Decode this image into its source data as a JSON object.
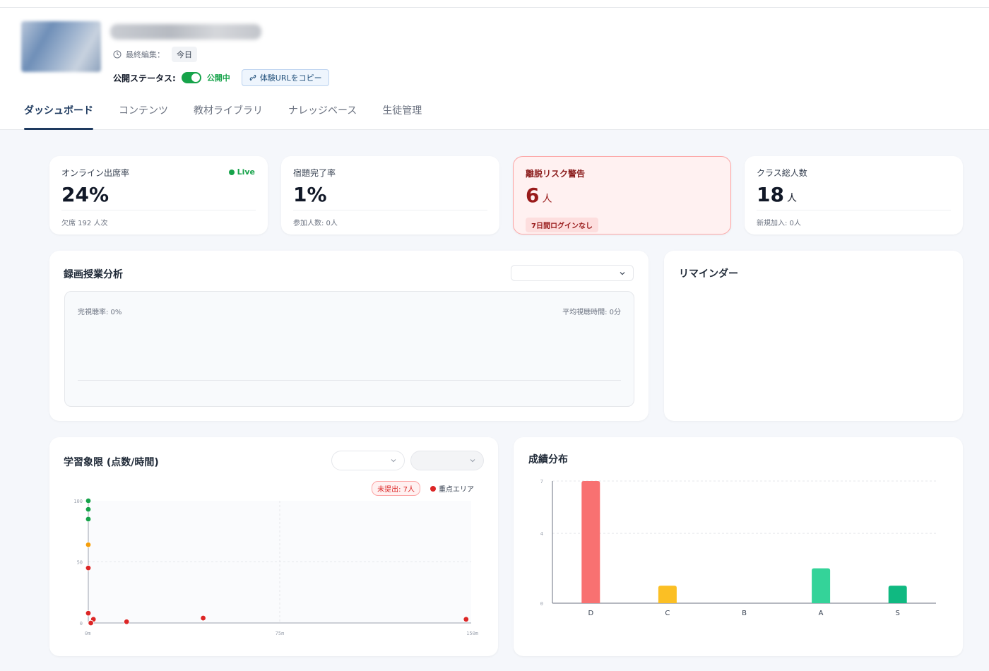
{
  "header": {
    "last_edited_label": "最終編集：",
    "last_edited_value": "今日",
    "status_label": "公開ステータス:",
    "status_value": "公開中",
    "copy_url_label": "体験URLをコピー"
  },
  "tabs": [
    {
      "label": "ダッシュボード"
    },
    {
      "label": "コンテンツ"
    },
    {
      "label": "教材ライブラリ"
    },
    {
      "label": "ナレッジベース"
    },
    {
      "label": "生徒管理"
    }
  ],
  "stats": {
    "attendance": {
      "title": "オンライン出席率",
      "value": "24%",
      "live": "Live",
      "sub": "欠席 192 人次"
    },
    "homework": {
      "title": "宿題完了率",
      "value": "1%",
      "sub": "参加人数: 0人"
    },
    "risk": {
      "title": "離脱リスク警告",
      "value": "6",
      "unit": "人",
      "badge": "7日間ログインなし"
    },
    "class_total": {
      "title": "クラス総人数",
      "value": "18",
      "unit": "人",
      "sub": "新規加入: 0人"
    }
  },
  "video_analysis": {
    "title": "録画授業分析",
    "completion": "完視聴率: 0%",
    "avg_time": "平均視聴時間: 0分"
  },
  "reminder": {
    "title": "リマインダー"
  },
  "quadrant": {
    "title": "学習象限 (点数/時間)",
    "unsubmitted_badge": "未提出: 7人",
    "legend_focus": "重点エリア"
  },
  "grade": {
    "title": "成績分布"
  },
  "colors": {
    "accent": "#1e3a5f",
    "green": "#16a34a",
    "red": "#dc2626",
    "orange": "#f59e0b"
  },
  "chart_data": [
    {
      "type": "scatter",
      "title": "学習象限 (点数/時間)",
      "xlabel": "",
      "ylabel": "",
      "x_ticks": [
        "0m",
        "75m",
        "150m"
      ],
      "y_ticks": [
        "0",
        "50",
        "100"
      ],
      "xlim": [
        0,
        150
      ],
      "ylim": [
        0,
        100
      ],
      "grid": true,
      "points": [
        {
          "x": 0,
          "y": 100,
          "color": "#16a34a"
        },
        {
          "x": 0,
          "y": 93,
          "color": "#16a34a"
        },
        {
          "x": 0,
          "y": 85,
          "color": "#16a34a"
        },
        {
          "x": 0,
          "y": 64,
          "color": "#f59e0b"
        },
        {
          "x": 0,
          "y": 45,
          "color": "#dc2626"
        },
        {
          "x": 0,
          "y": 8,
          "color": "#dc2626"
        },
        {
          "x": 2,
          "y": 3,
          "color": "#dc2626"
        },
        {
          "x": 1,
          "y": 0,
          "color": "#dc2626"
        },
        {
          "x": 15,
          "y": 1,
          "color": "#dc2626"
        },
        {
          "x": 45,
          "y": 4,
          "color": "#dc2626"
        },
        {
          "x": 148,
          "y": 3,
          "color": "#dc2626"
        }
      ]
    },
    {
      "type": "bar",
      "title": "成績分布",
      "categories": [
        "D",
        "C",
        "B",
        "A",
        "S"
      ],
      "values": [
        7,
        1,
        0,
        2,
        1
      ],
      "colors": [
        "#f87171",
        "#fbbf24",
        "#9ca3af",
        "#34d399",
        "#10b981"
      ],
      "y_ticks": [
        "0",
        "4",
        "7"
      ],
      "ylim": [
        0,
        7
      ],
      "grid": true
    }
  ]
}
